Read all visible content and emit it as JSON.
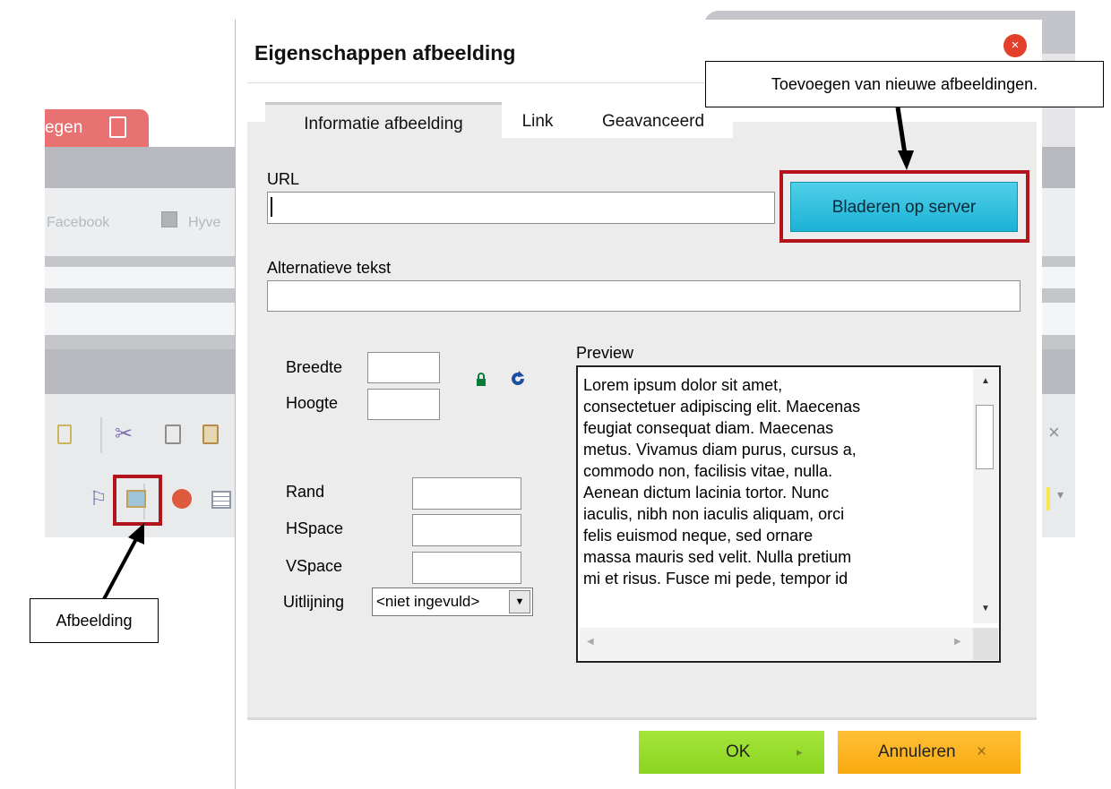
{
  "editor": {
    "tab_label": "egen",
    "facebook_label": "Facebook",
    "hyves_label": "Hyve",
    "toolbar_close": "×",
    "toolbar_dropdown": "▾"
  },
  "callouts": {
    "browse_note": "Toevoegen van nieuwe afbeeldingen.",
    "image_note": "Afbeelding"
  },
  "dialog": {
    "title": "Eigenschappen afbeelding",
    "close_symbol": "×",
    "tabs": [
      {
        "label": "Informatie afbeelding"
      },
      {
        "label": "Link"
      },
      {
        "label": "Geavanceerd"
      }
    ],
    "url_label": "URL",
    "url_value": "",
    "browse_button": "Bladeren op server",
    "alt_label": "Alternatieve tekst",
    "alt_value": "",
    "width_label": "Breedte",
    "height_label": "Hoogte",
    "border_label": "Rand",
    "hspace_label": "HSpace",
    "vspace_label": "VSpace",
    "align_label": "Uitlijning",
    "align_value": "<niet ingevuld>",
    "preview_label": "Preview",
    "preview_text": "Lorem ipsum dolor sit amet,\nconsectetuer adipiscing elit. Maecenas\nfeugiat consequat diam. Maecenas\nmetus. Vivamus diam purus, cursus a,\ncommodo non, facilisis vitae, nulla.\nAenean dictum lacinia tortor. Nunc\niaculis, nibh non iaculis aliquam, orci\nfelis euismod neque, sed ornare\nmassa mauris sed velit. Nulla pretium\nmi et risus. Fusce mi pede, tempor id",
    "ok_button": "OK",
    "ok_arrow": "▸",
    "cancel_button": "Annuleren",
    "cancel_symbol": "×"
  },
  "colors": {
    "highlight": "#b3141c",
    "browse_button": "#1cb2d6",
    "ok_button": "#8ad41f",
    "cancel_button": "#f9aa10",
    "editor_tab": "#e87272"
  }
}
